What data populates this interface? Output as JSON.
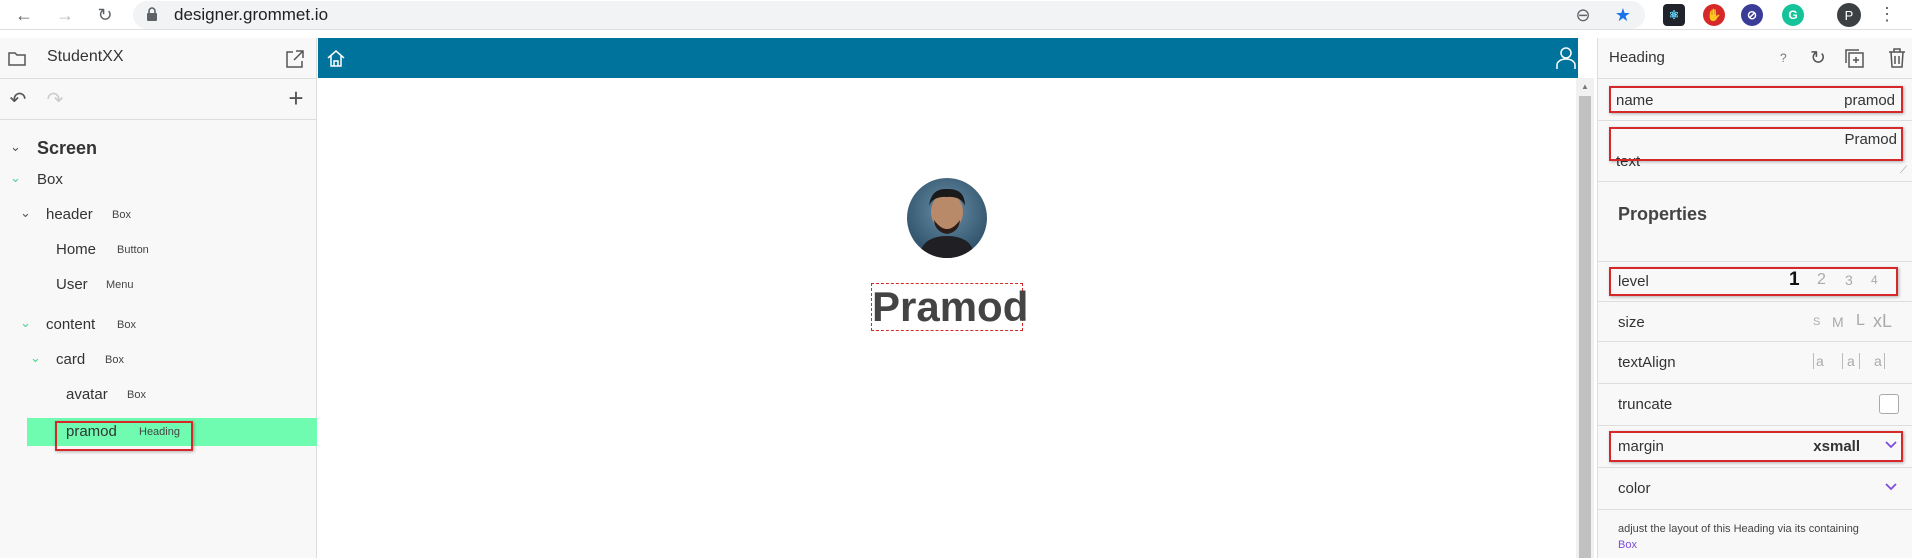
{
  "browser": {
    "url": "designer.grommet.io",
    "profile_initial": "P"
  },
  "left_panel": {
    "project_name": "StudentXX",
    "tree": [
      {
        "name": "Screen",
        "type": ""
      },
      {
        "name": "Box",
        "type": ""
      },
      {
        "name": "header",
        "type": "Box"
      },
      {
        "name": "Home",
        "type": "Button"
      },
      {
        "name": "User",
        "type": "Menu"
      },
      {
        "name": "content",
        "type": "Box"
      },
      {
        "name": "card",
        "type": "Box"
      },
      {
        "name": "avatar",
        "type": "Box"
      },
      {
        "name": "pramod",
        "type": "Heading"
      }
    ]
  },
  "canvas": {
    "heading_text": "Pramod"
  },
  "right_panel": {
    "title": "Heading",
    "help": "?",
    "name_label": "name",
    "name_value": "pramod",
    "text_label": "text",
    "text_value": "Pramod",
    "properties_title": "Properties",
    "level_label": "level",
    "level_options": [
      "1",
      "2",
      "3",
      "4"
    ],
    "level_selected": "1",
    "size_label": "size",
    "size_options": [
      "S",
      "M",
      "L",
      "xL"
    ],
    "textalign_label": "textAlign",
    "textalign_options": [
      "a",
      "a",
      "a"
    ],
    "truncate_label": "truncate",
    "margin_label": "margin",
    "margin_value": "xsmall",
    "color_label": "color",
    "note_text": "adjust the layout of this Heading via its containing",
    "note_link": "Box"
  },
  "colors": {
    "appbar": "#00739d",
    "selected_row": "#6ffcb0",
    "highlight_box": "#d62828",
    "chevron": "#4ad68f",
    "link": "#7d4cdb"
  }
}
